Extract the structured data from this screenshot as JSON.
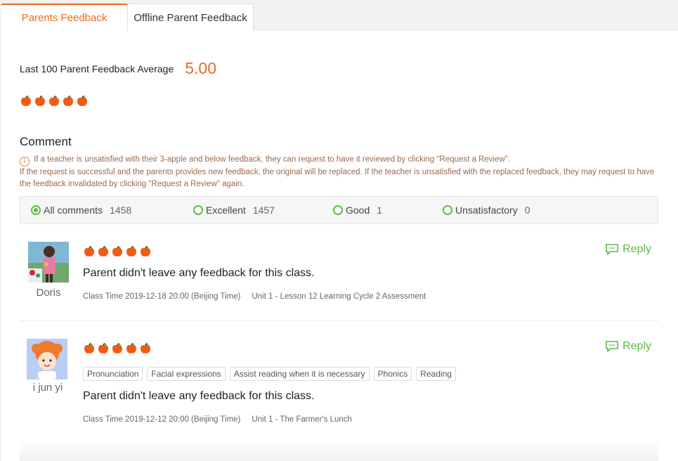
{
  "tabs": [
    {
      "label": "Parents Feedback",
      "active": true
    },
    {
      "label": "Offline Parent Feedback",
      "active": false
    }
  ],
  "summary": {
    "label": "Last 100 Parent Feedback Average",
    "value": "5.00",
    "apples": 5
  },
  "comment": {
    "title": "Comment",
    "notice_line1": "If a teacher is unsatisfied with their 3-apple and below feedback, they can request to have it reviewed by clicking \"Request a Review\".",
    "notice_line2": "If the request is successful and the parents provides new feedback, the original will be replaced. If the teacher is unsatisfied with the replaced feedback, they may request to have the feedback invalidated by clicking \"Request a Review\" again."
  },
  "filters": [
    {
      "label": "All comments",
      "count": "1458",
      "selected": true
    },
    {
      "label": "Excellent",
      "count": "1457",
      "selected": false
    },
    {
      "label": "Good",
      "count": "1",
      "selected": false
    },
    {
      "label": "Unsatisfactory",
      "count": "0",
      "selected": false
    }
  ],
  "items": [
    {
      "name": "Doris",
      "apples": 5,
      "reply": "Reply",
      "text": "Parent didn't leave any feedback for this class.",
      "class_time": "Class Time 2019-12-18 20:00 (Beijing Time)",
      "lesson": "Unit 1 - Lesson 12 Learning Cycle 2 Assessment",
      "tags": []
    },
    {
      "name": "i jun yi",
      "apples": 5,
      "reply": "Reply",
      "text": "Parent didn't leave any feedback for this class.",
      "class_time": "Class Time 2019-12-12 20:00 (Beijing Time)",
      "lesson": "Unit 1 - The Farmer's Lunch",
      "tags": [
        "Pronunciation",
        "Facial expressions",
        "Assist reading when it is necessary",
        "Phonics",
        "Reading"
      ]
    }
  ],
  "colors": {
    "accent": "#ef6a1f",
    "green": "#5fba46",
    "apple": "#f25a16"
  },
  "icons": {
    "apple": "apple-icon",
    "reply": "chat-bubble-icon",
    "info": "info-icon"
  }
}
